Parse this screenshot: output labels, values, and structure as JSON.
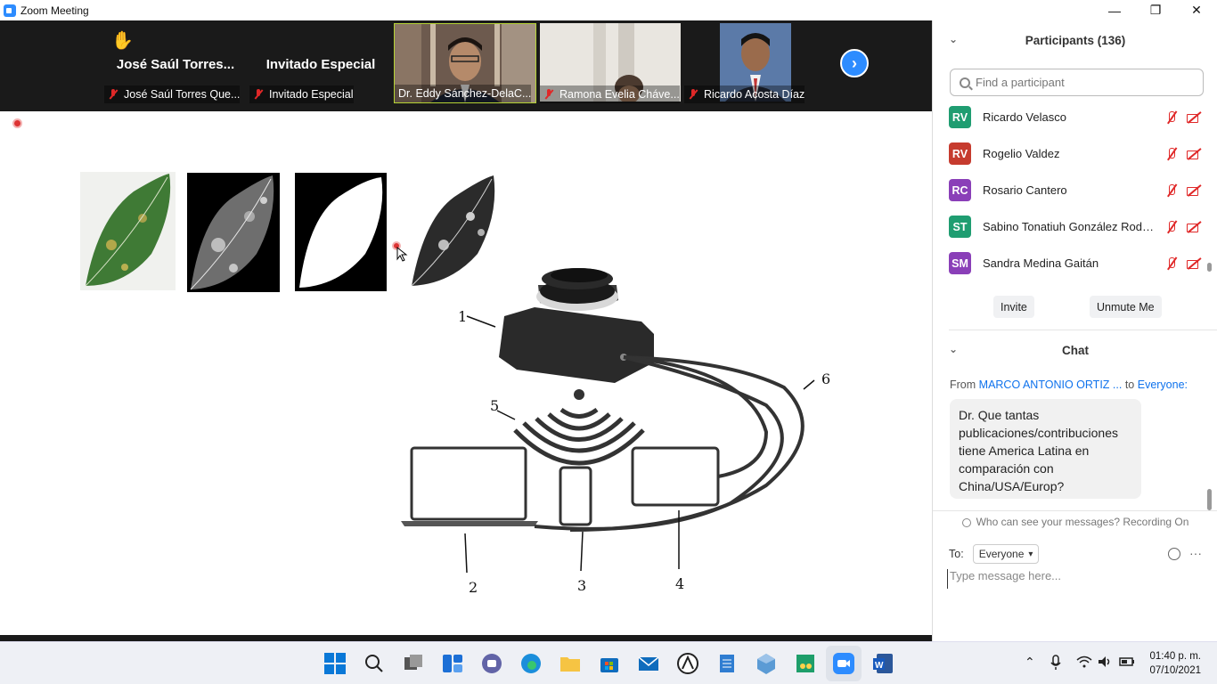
{
  "window": {
    "title": "Zoom Meeting"
  },
  "gallery": {
    "tiles": [
      {
        "big_name": "José Saúl Torres...",
        "label": "José Saúl Torres Que...",
        "hand_raised": true
      },
      {
        "big_name": "Invitado Especial",
        "label": "Invitado Especial"
      },
      {
        "label": "Dr. Eddy Sánchez-DelaC...",
        "active_speaker": true
      },
      {
        "label": "Ramona Evelia Cháve..."
      },
      {
        "label": "Ricardo Acosta Díaz"
      }
    ]
  },
  "shared_figure": {
    "labels": [
      "1",
      "2",
      "3",
      "4",
      "5",
      "6"
    ]
  },
  "participants": {
    "header": "Participants (136)",
    "search_placeholder": "Find a participant",
    "rows": [
      {
        "initials": "RV",
        "name": "Ricardo Velasco",
        "color": "#1f9d71"
      },
      {
        "initials": "RV",
        "name": "Rogelio Valdez",
        "color": "#c63b2e"
      },
      {
        "initials": "RC",
        "name": "Rosario Cantero",
        "color": "#8a3fb8"
      },
      {
        "initials": "ST",
        "name": "Sabino Tonatiuh González Rodrí...",
        "color": "#1f9d71"
      },
      {
        "initials": "SM",
        "name": "Sandra Medina Gaitán",
        "color": "#8a3fb8"
      }
    ],
    "invite_label": "Invite",
    "unmute_label": "Unmute Me"
  },
  "chat": {
    "header": "Chat",
    "from_prefix": "From",
    "from_name": "MARCO ANTONIO ORTIZ ...",
    "to_prefix": "to",
    "to_name": "Everyone:",
    "message": "Dr. Que tantas publicaciones/contribuciones tiene America Latina en comparación con China/USA/Europ?",
    "who_can_see": "Who can see your messages? Recording On",
    "to_label": "To:",
    "to_value": "Everyone",
    "input_placeholder": "Type message here..."
  },
  "taskbar": {
    "time": "01:40 p. m.",
    "date": "07/10/2021"
  },
  "colors": {
    "accent": "#2d8cff",
    "speaker_border": "#b5d334",
    "muted": "#e02828"
  }
}
